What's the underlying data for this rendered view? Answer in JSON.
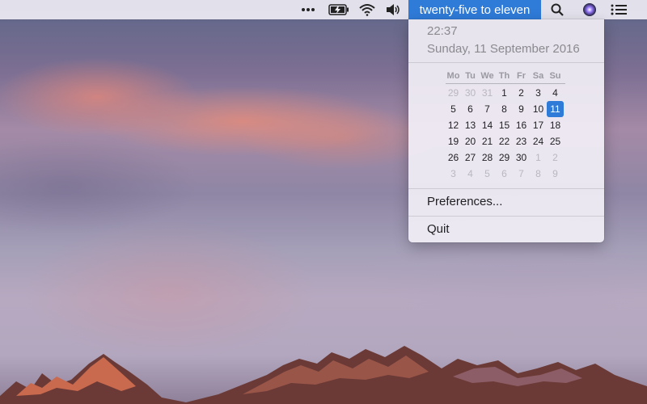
{
  "menubar": {
    "title": "twenty-five to eleven",
    "status_icons": [
      "more-icon",
      "battery-charging-icon",
      "wifi-icon",
      "volume-icon",
      "search-icon",
      "siri-icon",
      "list-icon"
    ]
  },
  "clock_menu": {
    "time": "22:37",
    "date": "Sunday, 11 September 2016",
    "calendar": {
      "weekdays": [
        "Mo",
        "Tu",
        "We",
        "Th",
        "Fr",
        "Sa",
        "Su"
      ],
      "weeks": [
        [
          "29",
          "30",
          "31",
          "1",
          "2",
          "3",
          "4"
        ],
        [
          "5",
          "6",
          "7",
          "8",
          "9",
          "10",
          "11"
        ],
        [
          "12",
          "13",
          "14",
          "15",
          "16",
          "17",
          "18"
        ],
        [
          "19",
          "20",
          "21",
          "22",
          "23",
          "24",
          "25"
        ],
        [
          "26",
          "27",
          "28",
          "29",
          "30",
          "1",
          "2"
        ],
        [
          "3",
          "4",
          "5",
          "6",
          "7",
          "8",
          "9"
        ]
      ],
      "today": "11"
    },
    "items": [
      "Preferences...",
      "Quit"
    ]
  },
  "colors": {
    "accent": "#2f7bd8",
    "menu_background": "#f2eff6"
  }
}
